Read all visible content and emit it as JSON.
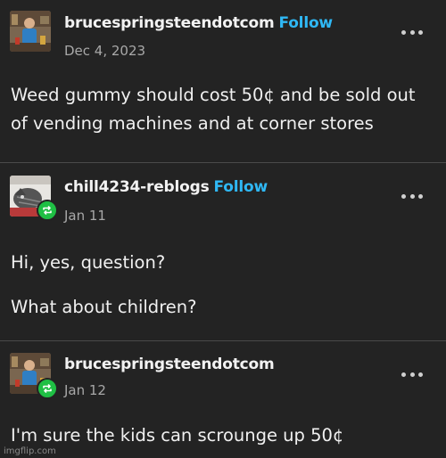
{
  "posts": [
    {
      "username": "brucespringsteendotcom",
      "follow_label": "Follow",
      "date": "Dec 4, 2023",
      "avatar_icon": "avatar-person-photo",
      "paragraphs": [
        "Weed gummy should cost 50¢ and be sold out of vending machines and at corner stores"
      ]
    },
    {
      "username": "chill4234-reblogs",
      "follow_label": "Follow",
      "date": "Jan 11",
      "avatar_icon": "avatar-cat-photo",
      "reblog_icon": "reblog-icon",
      "paragraphs": [
        "Hi, yes, question?",
        "What about children?"
      ]
    },
    {
      "username": "brucespringsteendotcom",
      "date": "Jan 12",
      "avatar_icon": "avatar-person-photo",
      "reblog_icon": "reblog-icon",
      "paragraphs": [
        "I'm sure the kids can scrounge up 50¢"
      ]
    }
  ],
  "more_icon": "more-options-icon",
  "watermark": "imgflip.com",
  "colors": {
    "background": "#232323",
    "follow": "#2fb8f5",
    "reblog_badge": "#1fbf44",
    "divider": "#4a4a4a"
  }
}
